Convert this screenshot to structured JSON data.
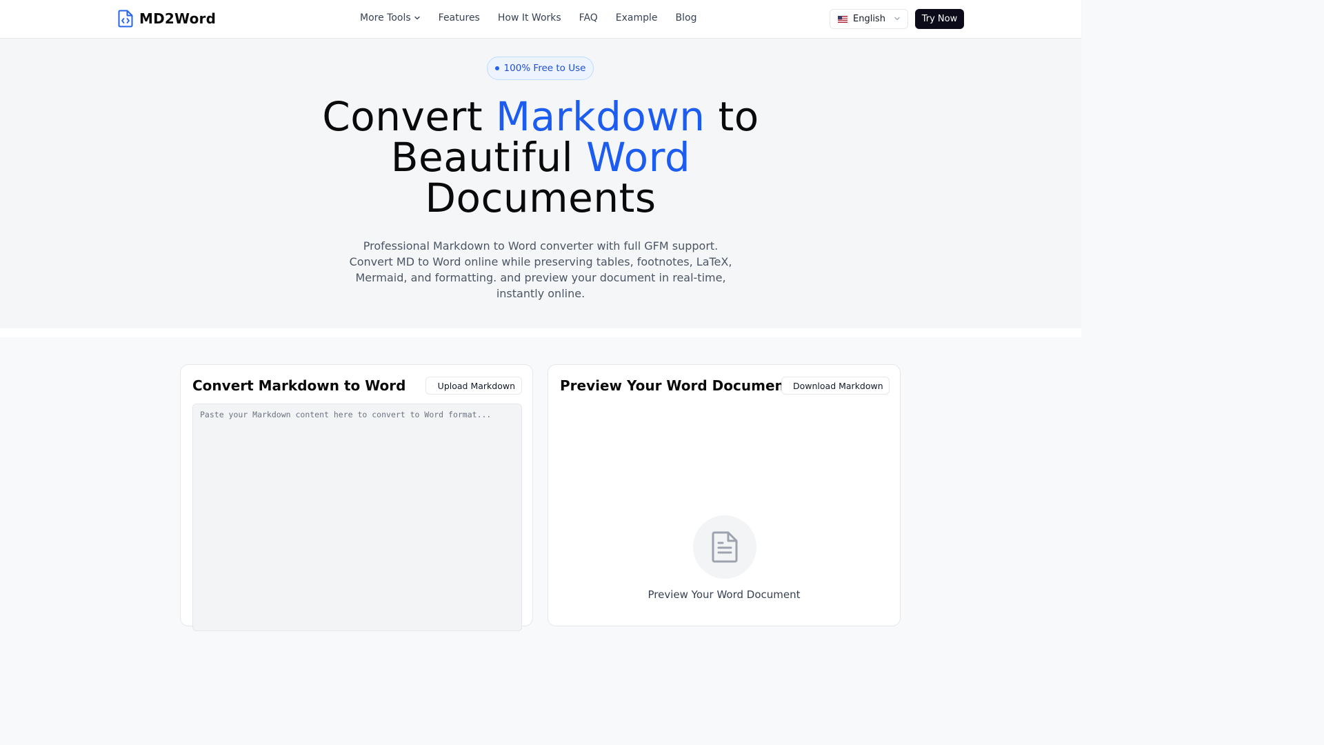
{
  "header": {
    "logo_icon": "file-code-icon",
    "logo_text": "MD2Word",
    "nav": [
      {
        "label": "More Tools",
        "has_dropdown": true
      },
      {
        "label": "Features"
      },
      {
        "label": "How It Works"
      },
      {
        "label": "FAQ"
      },
      {
        "label": "Example"
      },
      {
        "label": "Blog"
      }
    ],
    "language": {
      "flag": "us-flag-icon",
      "selected": "English"
    },
    "cta_label": "Try Now"
  },
  "hero": {
    "badge": "100% Free to Use",
    "title_parts": [
      "Convert ",
      "Markdown",
      " to",
      "Beautiful ",
      "Word",
      "Documents"
    ],
    "description": "Professional Markdown to Word converter with full GFM support. Convert MD to Word online while preserving tables, footnotes, LaTeX, Mermaid, and formatting. and preview your document in real-time, instantly online."
  },
  "editor_card": {
    "title": "Convert Markdown to Word",
    "upload_label": "Upload Markdown",
    "upload_icon": "upload-icon",
    "editor_value": "",
    "editor_placeholder": "Paste your Markdown content here to convert to Word format..."
  },
  "preview_card": {
    "title": "Preview Your Word Document",
    "download_label": "Download Markdown",
    "download_icon": "download-icon",
    "empty_icon": "document-icon",
    "empty_text": "Preview Your Word Document"
  },
  "colors": {
    "accent": "#1d5cf0",
    "cta_bg": "#0b0b1a",
    "badge_bg": "#eef4ff",
    "badge_text": "#1d4ed8"
  }
}
